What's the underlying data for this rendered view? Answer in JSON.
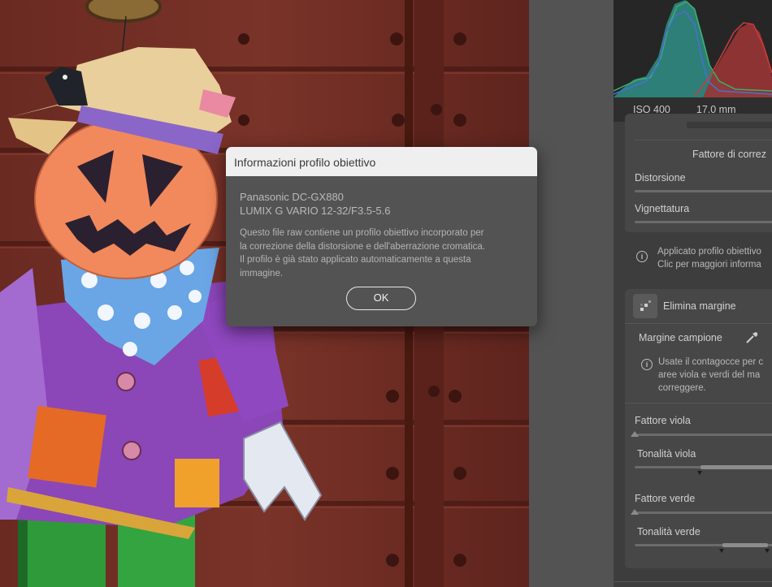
{
  "image": {
    "subject": "scarecrow-photo"
  },
  "histogram": {
    "colors": {
      "blue": "#4a6fd0",
      "green": "#3fae6a",
      "red": "#d03a3a",
      "teal_fill": "#2f8f86",
      "red_fill": "#9a3535"
    }
  },
  "exif": {
    "iso": "ISO 400",
    "focal_length": "17.0 mm"
  },
  "lens_panel": {
    "correction_factor_label": "Fattore di correz",
    "distortion_label": "Distorsione",
    "vignetting_label": "Vignettatura",
    "applied_note_line1": "Applicato profilo obiettivo",
    "applied_note_line2": "Clic per maggiori informa"
  },
  "defringe_panel": {
    "title": "Elimina margine",
    "sample_label": "Margine campione",
    "note_lines": [
      "Usate il contagocce per c",
      "aree viola e verdi del ma",
      "correggere."
    ],
    "purple_amount_label": "Fattore viola",
    "purple_hue_label": "Tonalità viola",
    "green_amount_label": "Fattore verde",
    "green_hue_label": "Tonalità verde"
  },
  "dialog": {
    "title": "Informazioni profilo obiettivo",
    "camera": "Panasonic DC-GX880",
    "lens": "LUMIX G VARIO 12-32/F3.5-5.6",
    "message": "Questo file raw contiene un profilo obiettivo incorporato per\nla correzione della distorsione e dell'aberrazione cromatica.\nIl profilo è già stato applicato automaticamente a questa\nimmagine.",
    "ok_label": "OK"
  },
  "icons": {
    "info": "info-icon",
    "eyedropper": "eyedropper-icon",
    "defringe": "defringe-icon"
  }
}
